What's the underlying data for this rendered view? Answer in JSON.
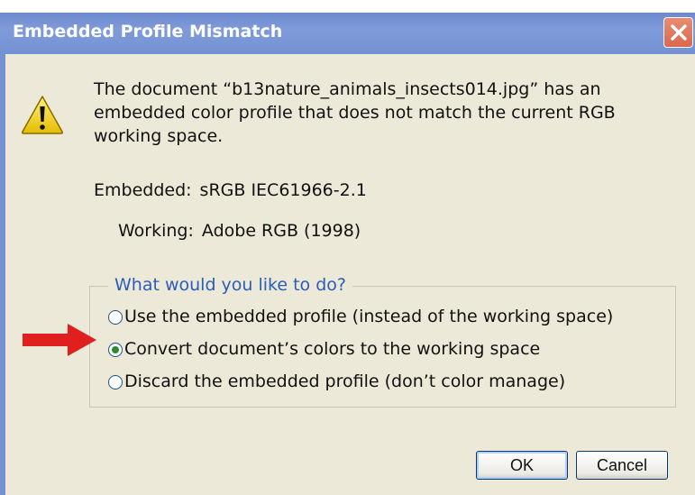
{
  "dialog": {
    "title": "Embedded Profile Mismatch",
    "message": "The document “b13nature_animals_insects014.jpg” has an embedded color profile that does not match the current RGB working space.",
    "embedded_label": "Embedded:",
    "embedded_value": "sRGB IEC61966-2.1",
    "working_label": "Working:",
    "working_value": "Adobe RGB (1998)",
    "group_label": "What would you like to do?",
    "options": [
      {
        "label": "Use the embedded profile (instead of the working space)",
        "selected": false
      },
      {
        "label": "Convert document’s colors to the working space",
        "selected": true
      },
      {
        "label": "Discard the embedded profile (don’t color manage)",
        "selected": false
      }
    ],
    "ok_label": "OK",
    "cancel_label": "Cancel"
  },
  "colors": {
    "titlebar": "#7f9bd9",
    "dialog_bg": "#ece9d8",
    "legend_text": "#2a5db8",
    "arrow": "#e0201e",
    "radio_dot": "#2f8b2f",
    "close_button": "#d9684e"
  },
  "icons": {
    "warning": "warning-triangle-icon",
    "close": "close-x-icon",
    "annotation_arrow": "red-arrow-icon"
  }
}
